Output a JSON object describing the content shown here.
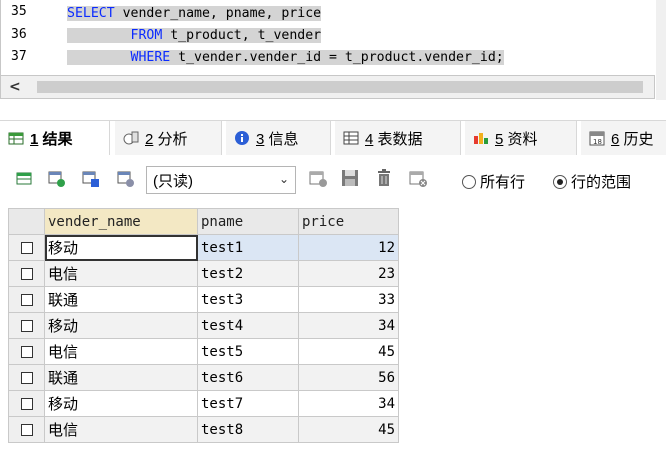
{
  "editor": {
    "lines": [
      {
        "no": "35",
        "kw": "SELECT",
        "rest": " vender_name, pname, price"
      },
      {
        "no": "36",
        "kw": "FROM",
        "rest": " t_product, t_vender"
      },
      {
        "no": "37",
        "kw": "WHERE",
        "rest": " t_vender.vender_id = t_product.vender_id;"
      }
    ],
    "scroll_left_arrow": "<"
  },
  "tabs": [
    {
      "num": "1",
      "label": "结果",
      "icon": "result-grid-icon"
    },
    {
      "num": "2",
      "label": "分析",
      "icon": "profiler-icon"
    },
    {
      "num": "3",
      "label": "信息",
      "icon": "info-icon"
    },
    {
      "num": "4",
      "label": "表数据",
      "icon": "table-data-icon"
    },
    {
      "num": "5",
      "label": "资料",
      "icon": "info-chart-icon"
    },
    {
      "num": "6",
      "label": "历史",
      "icon": "history-calendar-icon"
    }
  ],
  "toolbar": {
    "mode_value": "(只读)",
    "radio_all_rows": "所有行",
    "radio_row_range": "行的范围",
    "radio_selected": "row_range"
  },
  "grid": {
    "columns": [
      "vender_name",
      "pname",
      "price"
    ],
    "rows": [
      {
        "vender_name": "移动",
        "pname": "test1",
        "price": "12"
      },
      {
        "vender_name": "电信",
        "pname": "test2",
        "price": "23"
      },
      {
        "vender_name": "联通",
        "pname": "test3",
        "price": "33"
      },
      {
        "vender_name": "移动",
        "pname": "test4",
        "price": "34"
      },
      {
        "vender_name": "电信",
        "pname": "test5",
        "price": "45"
      },
      {
        "vender_name": "联通",
        "pname": "test6",
        "price": "56"
      },
      {
        "vender_name": "移动",
        "pname": "test7",
        "price": "34"
      },
      {
        "vender_name": "电信",
        "pname": "test8",
        "price": "45"
      }
    ]
  },
  "colors": {
    "keyword": "#0b2bff",
    "selection": "#d4d4d4",
    "header_sorted": "#f3e8c4"
  }
}
